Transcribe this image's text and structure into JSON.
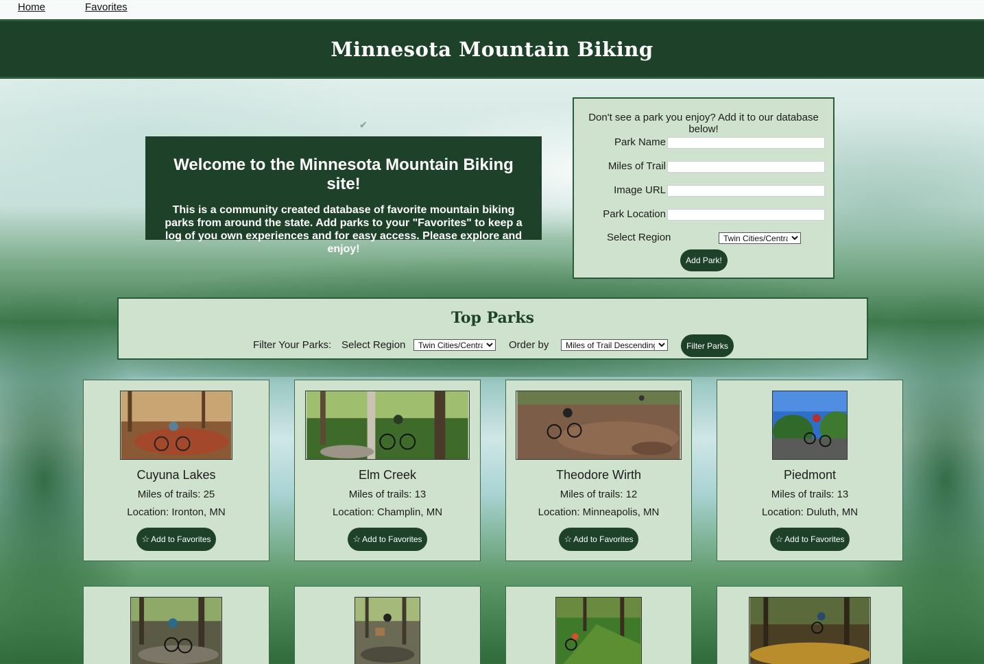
{
  "nav": {
    "home": "Home",
    "favorites": "Favorites"
  },
  "header": {
    "title": "Minnesota Mountain Biking"
  },
  "welcome": {
    "heading": "Welcome to the Minnesota Mountain Biking site!",
    "body": "This is a community created database of favorite mountain biking parks from around the state. Add parks to your \"Favorites\" to keep a log of you own experiences and for easy access. Please explore and enjoy!"
  },
  "add_form": {
    "intro": "Don't see a park you enjoy? Add it to our database below!",
    "park_name_label": "Park Name",
    "miles_label": "Miles of Trail",
    "image_url_label": "Image URL",
    "location_label": "Park Location",
    "region_label": "Select Region",
    "region_value": "Twin Cities/Central",
    "submit_label": "Add Park!"
  },
  "top_parks": {
    "heading": "Top Parks",
    "filter_label": "Filter Your Parks:",
    "region_label": "Select Region",
    "region_value": "Twin Cities/Central",
    "order_label": "Order by",
    "order_value": "Miles of Trail Descending",
    "filter_button": "Filter Parks"
  },
  "parks": [
    {
      "name": "Cuyuna Lakes",
      "miles": "Miles of trails: 25",
      "location": "Location: Ironton, MN",
      "fav_label": "Add to Favorites"
    },
    {
      "name": "Elm Creek",
      "miles": "Miles of trails: 13",
      "location": "Location: Champlin, MN",
      "fav_label": "Add to Favorites"
    },
    {
      "name": "Theodore Wirth",
      "miles": "Miles of trails: 12",
      "location": "Location: Minneapolis, MN",
      "fav_label": "Add to Favorites"
    },
    {
      "name": "Piedmont",
      "miles": "Miles of trails: 13",
      "location": "Location: Duluth, MN",
      "fav_label": "Add to Favorites"
    }
  ],
  "icons": {
    "favorite": "star-outline-icon"
  },
  "colors": {
    "brand_dark_green": "#1d4229",
    "panel_light_green": "#cfe2cd"
  }
}
